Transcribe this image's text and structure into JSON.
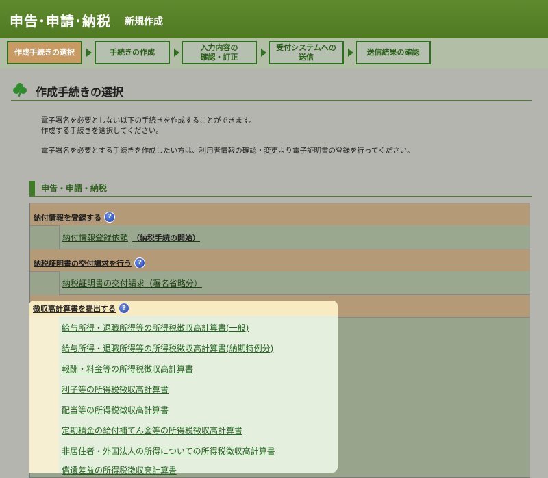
{
  "header": {
    "title": "申告･申請･納税",
    "subtitle": "新規作成"
  },
  "steps": [
    {
      "label": "作成手続きの選択"
    },
    {
      "label": "手続きの作成"
    },
    {
      "label": "入力内容の\n確認・訂正"
    },
    {
      "label": "受付システムへの\n送信"
    },
    {
      "label": "送信結果の確認"
    }
  ],
  "page": {
    "title": "作成手続きの選択",
    "desc1": "電子署名を必要としない以下の手続きを作成することができます。",
    "desc2": "作成する手続きを選択してください。",
    "desc3": "電子署名を必要とする手続きを作成したい方は、利用者情報の確認・変更より電子証明書の登録を行ってください。"
  },
  "section": {
    "title": "申告・申請・納税"
  },
  "categories": [
    {
      "label": "納付情報を登録する",
      "items": [
        {
          "label": "納付情報登録依頼",
          "note": "（納税手続の開始）"
        }
      ]
    },
    {
      "label": "納税証明書の交付請求を行う",
      "items": [
        {
          "label": "納税証明書の交付請求（署名省略分）"
        }
      ]
    },
    {
      "label": "徴収高計算書を提出する",
      "items": [
        {
          "label": "給与所得・退職所得等の所得税徴収高計算書(一般)"
        },
        {
          "label": "給与所得・退職所得等の所得税徴収高計算書(納期特例分)"
        },
        {
          "label": "報酬・料金等の所得税徴収高計算書"
        },
        {
          "label": "利子等の所得税徴収高計算書"
        },
        {
          "label": "配当等の所得税徴収高計算書"
        },
        {
          "label": "定期積金の給付補てん金等の所得税徴収高計算書"
        },
        {
          "label": "非居住者・外国法人の所得についての所得税徴収高計算書"
        },
        {
          "label": "償還差益の所得税徴収高計算書"
        }
      ]
    }
  ],
  "help_icon": "?",
  "colors": {
    "header": "#5a8630",
    "accent_green": "#2f6e1e",
    "active_step": "#c99a62"
  }
}
